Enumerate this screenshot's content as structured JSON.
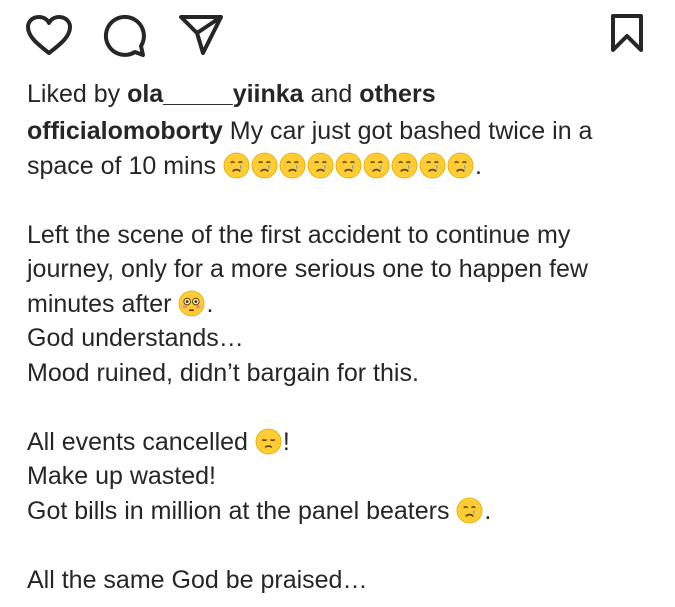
{
  "actions": {
    "like_icon": "heart-icon",
    "comment_icon": "comment-icon",
    "share_icon": "paper-plane-icon",
    "save_icon": "bookmark-icon"
  },
  "likes": {
    "prefix": "Liked by ",
    "user": "ola_____yiinka",
    "middle": " and ",
    "others": "others"
  },
  "caption": {
    "username": "officialomoborty",
    "line1": " My car just got bashed twice in a",
    "line2": "space of 10 mins ",
    "line2_emoji": "crying-face",
    "line2_emoji_count": 9,
    "line2_end": ".",
    "line3": "Left the scene of the first accident to continue my",
    "line4": "journey, only for a more serious one to happen few",
    "line5": "minutes after ",
    "line5_emoji": "flushed-face",
    "line5_end": ".",
    "line6": "God understands…",
    "line7": "Mood ruined, didn’t bargain for this.",
    "line8": "All events cancelled ",
    "line8_emoji": "disappointed-face",
    "line8_end": "!",
    "line9": "Make up wasted!",
    "line10": "Got bills in million at the panel beaters ",
    "line10_emoji": "crying-face",
    "line10_end": ".",
    "line11": "All the same God be praised…"
  },
  "colors": {
    "text": "#262626",
    "emoji_face": "#FFCC33",
    "emoji_tear": "#5DADE2"
  }
}
